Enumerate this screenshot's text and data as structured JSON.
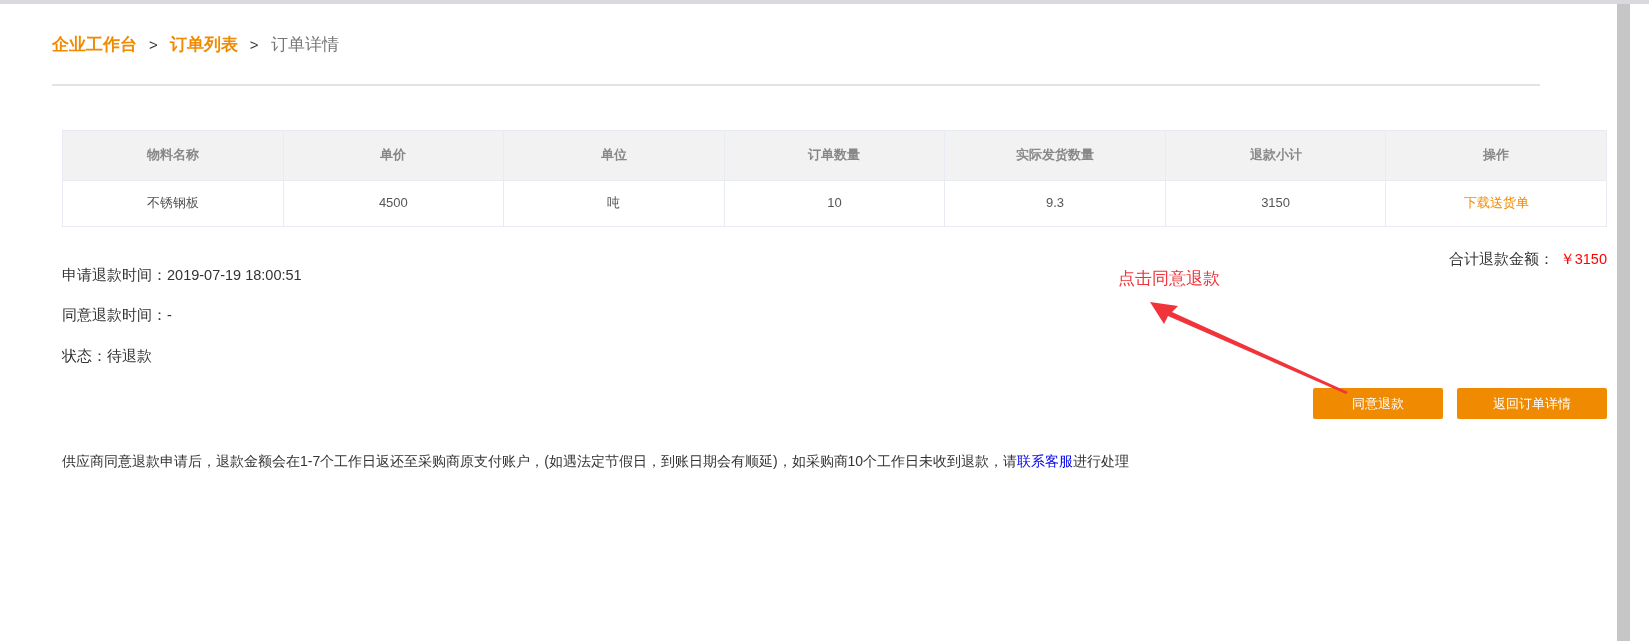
{
  "breadcrumb": [
    {
      "label": "企业工作台",
      "kind": "link"
    },
    {
      "label": "订单列表",
      "kind": "link"
    },
    {
      "label": "订单详情",
      "kind": "current"
    }
  ],
  "breadcrumb_separator": ">",
  "table": {
    "columns": [
      "物料名称",
      "单价",
      "单位",
      "订单数量",
      "实际发货数量",
      "退款小计",
      "操作"
    ],
    "rows": [
      {
        "cells": [
          "不锈钢板",
          "4500",
          "吨",
          "10",
          "9.3",
          "3150"
        ],
        "action": "下载送货单"
      }
    ]
  },
  "total": {
    "label": "合计退款金额：",
    "value": "￥3150"
  },
  "info": [
    "申请退款时间：2019-07-19 18:00:51",
    "同意退款时间：-",
    "状态：待退款"
  ],
  "annotation": {
    "text": "点击同意退款"
  },
  "buttons": [
    "同意退款",
    "返回订单详情"
  ],
  "notice": {
    "before": "供应商同意退款申请后，退款金额会在1-7个工作日返还至采购商原支付账户，(如遇法定节假日，到账日期会有顺延)，如采购商10个工作日未收到退款，请",
    "link": "联系客服",
    "after": "进行处理"
  }
}
